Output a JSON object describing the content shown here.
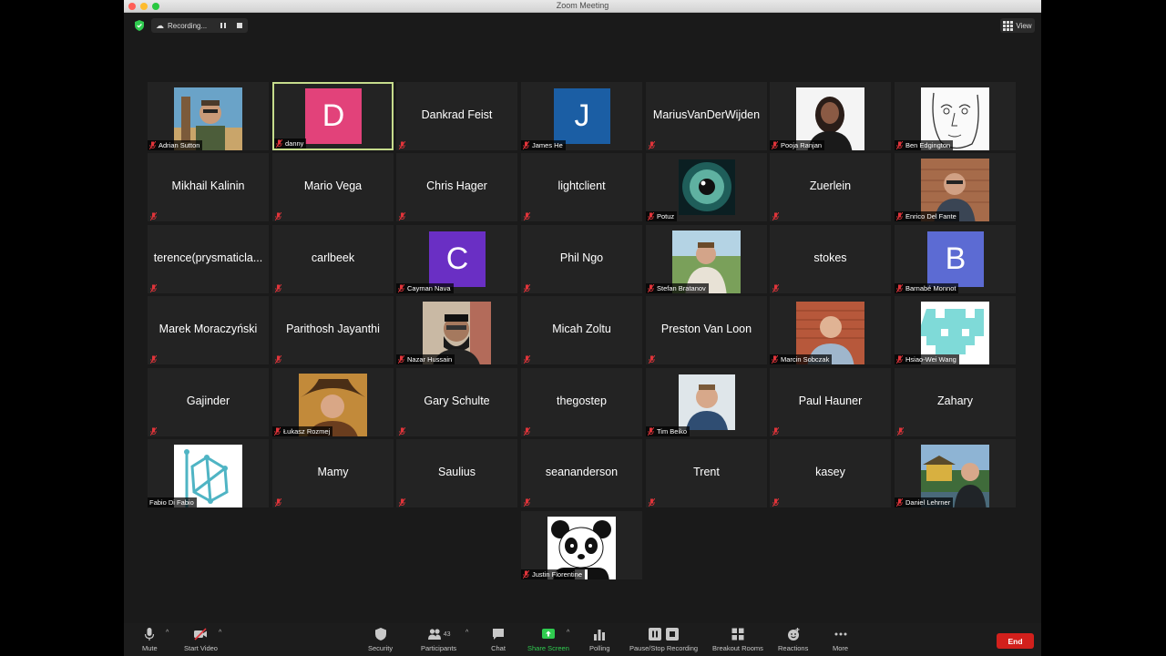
{
  "window": {
    "title": "Zoom Meeting"
  },
  "recording": {
    "label": "Recording..."
  },
  "view": {
    "label": "View"
  },
  "tiles": [
    {
      "name": "Adrian Sutton",
      "kind": "photo",
      "photo": "beach"
    },
    {
      "name": "danny",
      "kind": "avatar",
      "letter": "D",
      "color": "#e2427a",
      "active": true
    },
    {
      "name": "Dankrad Feist",
      "kind": "text"
    },
    {
      "name": "James He",
      "kind": "avatar",
      "letter": "J",
      "color": "#1b5ea4"
    },
    {
      "name": "MariusVanDerWijden",
      "kind": "text"
    },
    {
      "name": "Pooja Ranjan",
      "kind": "photo",
      "photo": "portrait-white"
    },
    {
      "name": "Ben Edgington",
      "kind": "photo",
      "photo": "sketch"
    },
    {
      "name": "Mikhail Kalinin",
      "kind": "text"
    },
    {
      "name": "Mario Vega",
      "kind": "text"
    },
    {
      "name": "Chris Hager",
      "kind": "text"
    },
    {
      "name": "lightclient",
      "kind": "text"
    },
    {
      "name": "Potuz",
      "kind": "photo",
      "photo": "eye"
    },
    {
      "name": "Zuerlein",
      "kind": "text"
    },
    {
      "name": "Enrico Del Fante",
      "kind": "photo",
      "photo": "brick"
    },
    {
      "name": "terence(prysmaticla...",
      "kind": "text"
    },
    {
      "name": "carlbeek",
      "kind": "text"
    },
    {
      "name": "Cayman Nava",
      "kind": "avatar",
      "letter": "C",
      "color": "#6a2fc4"
    },
    {
      "name": "Phil Ngo",
      "kind": "text"
    },
    {
      "name": "Stefan Bratanov",
      "kind": "photo",
      "photo": "outdoor"
    },
    {
      "name": "stokes",
      "kind": "text"
    },
    {
      "name": "Barnabé Monnot",
      "kind": "avatar",
      "letter": "B",
      "color": "#5c6bd3"
    },
    {
      "name": "Marek Moraczyński",
      "kind": "text"
    },
    {
      "name": "Parithosh Jayanthi",
      "kind": "text"
    },
    {
      "name": "Nazar Hussain",
      "kind": "photo",
      "photo": "room"
    },
    {
      "name": "Micah Zoltu",
      "kind": "text"
    },
    {
      "name": "Preston Van Loon",
      "kind": "text"
    },
    {
      "name": "Marcin Sobczak",
      "kind": "photo",
      "photo": "brick-wall"
    },
    {
      "name": "Hsiao-Wei Wang",
      "kind": "photo",
      "photo": "pixel"
    },
    {
      "name": "Gajinder",
      "kind": "text"
    },
    {
      "name": "Łukasz Rozmej",
      "kind": "photo",
      "photo": "cowboy"
    },
    {
      "name": "Gary Schulte",
      "kind": "text"
    },
    {
      "name": "thegostep",
      "kind": "text"
    },
    {
      "name": "Tim Beiko",
      "kind": "photo",
      "photo": "light"
    },
    {
      "name": "Paul Hauner",
      "kind": "text"
    },
    {
      "name": "Zahary",
      "kind": "text"
    },
    {
      "name": "Fabio Di Fabio",
      "kind": "photo",
      "photo": "logo"
    },
    {
      "name": "Mamy",
      "kind": "text"
    },
    {
      "name": "Saulius",
      "kind": "text"
    },
    {
      "name": "seananderson",
      "kind": "text"
    },
    {
      "name": "Trent",
      "kind": "text"
    },
    {
      "name": "kasey",
      "kind": "text"
    },
    {
      "name": "Daniel Lehrner",
      "kind": "photo",
      "photo": "temple"
    },
    {
      "name": "Justin Florentine",
      "kind": "photo",
      "photo": "panda"
    }
  ],
  "toolbar": {
    "mute": "Mute",
    "start_video": "Start Video",
    "security": "Security",
    "participants": "Participants",
    "participants_count": "43",
    "chat": "Chat",
    "share_screen": "Share Screen",
    "polling": "Polling",
    "pause_stop": "Pause/Stop Recording",
    "breakout": "Breakout Rooms",
    "reactions": "Reactions",
    "more": "More",
    "end": "End"
  },
  "colors": {
    "share_green": "#2fcb4f",
    "end_red": "#d2201c",
    "active_border": "#c6dc8c"
  }
}
